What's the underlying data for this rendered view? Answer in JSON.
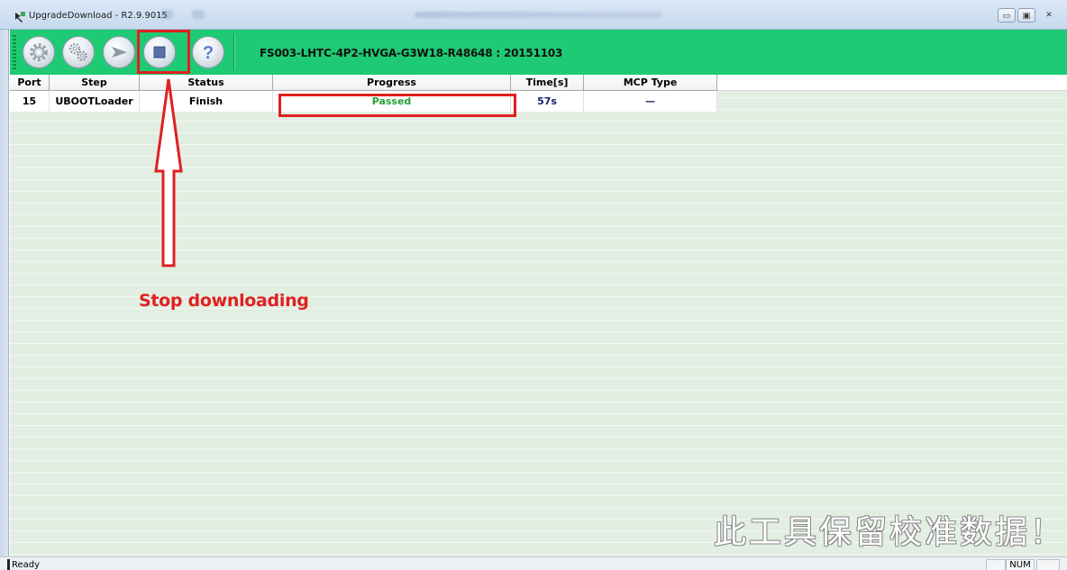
{
  "window": {
    "title": "UpgradeDownload - R2.9.9015",
    "minimize_glyph": "▭",
    "maximize_glyph": "▣",
    "close_glyph": "✕"
  },
  "toolbar": {
    "firmware_label": "FS003-LHTC-4P2-HVGA-G3W18-R48648 : 20151103",
    "buttons": [
      {
        "icon": "gear-icon"
      },
      {
        "icon": "gears-icon"
      },
      {
        "icon": "play-arrow-icon"
      },
      {
        "icon": "stop-icon"
      },
      {
        "icon": "help-icon",
        "glyph": "?"
      }
    ]
  },
  "table": {
    "headers": [
      "Port",
      "Step",
      "Status",
      "Progress",
      "Time[s]",
      "MCP Type"
    ],
    "rows": [
      {
        "port": "15",
        "step": "UBOOTLoader",
        "status": "Finish",
        "progress": "Passed",
        "time": "57s",
        "mcp_type": "—"
      }
    ]
  },
  "annotation": {
    "text": "Stop downloading",
    "color": "#e02020"
  },
  "watermark": "此工具保留校准数据！",
  "statusbar": {
    "text": "Ready",
    "num": "NUM"
  },
  "colors": {
    "toolbar_green": "#1ecb74",
    "passed_green": "#25a236",
    "highlight_red": "#e02020"
  }
}
